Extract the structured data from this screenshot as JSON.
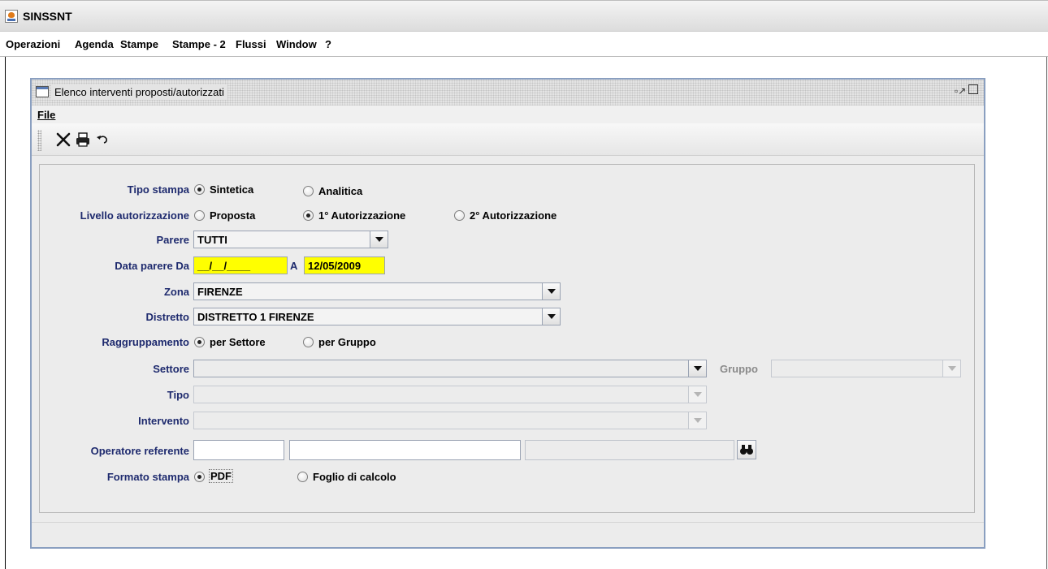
{
  "app": {
    "title": "SINSSNT"
  },
  "menubar": [
    "Operazioni",
    "Agenda",
    "Stampe",
    "Stampe - 2",
    "Flussi",
    "Window",
    "?"
  ],
  "window": {
    "title": "Elenco interventi proposti/autorizzati",
    "menu_file": "File"
  },
  "toolbar": {
    "icons": [
      "close-icon",
      "printer-icon",
      "undo-icon"
    ]
  },
  "form": {
    "tipo_stampa": {
      "label": "Tipo stampa",
      "options": [
        "Sintetica",
        "Analitica"
      ],
      "selected": "Sintetica"
    },
    "livello": {
      "label": "Livello autorizzazione",
      "options": [
        "Proposta",
        "1° Autorizzazione",
        "2° Autorizzazione"
      ],
      "selected": "1° Autorizzazione"
    },
    "parere": {
      "label": "Parere",
      "value": "TUTTI"
    },
    "data_parere": {
      "label": "Data parere  Da",
      "from": "__/__/____",
      "to_label": "A",
      "to": "12/05/2009"
    },
    "zona": {
      "label": "Zona",
      "value": "FIRENZE"
    },
    "distretto": {
      "label": "Distretto",
      "value": "DISTRETTO 1 FIRENZE"
    },
    "raggruppamento": {
      "label": "Raggruppamento",
      "options": [
        "per Settore",
        "per Gruppo"
      ],
      "selected": "per Settore"
    },
    "settore": {
      "label": "Settore",
      "value": ""
    },
    "gruppo": {
      "label": "Gruppo",
      "value": ""
    },
    "tipo": {
      "label": "Tipo",
      "value": ""
    },
    "intervento": {
      "label": "Intervento",
      "value": ""
    },
    "operatore": {
      "label": "Operatore referente",
      "code": "",
      "name": "",
      "extra": ""
    },
    "formato": {
      "label": "Formato stampa",
      "options": [
        "PDF",
        "Foglio di calcolo"
      ],
      "selected": "PDF"
    }
  }
}
